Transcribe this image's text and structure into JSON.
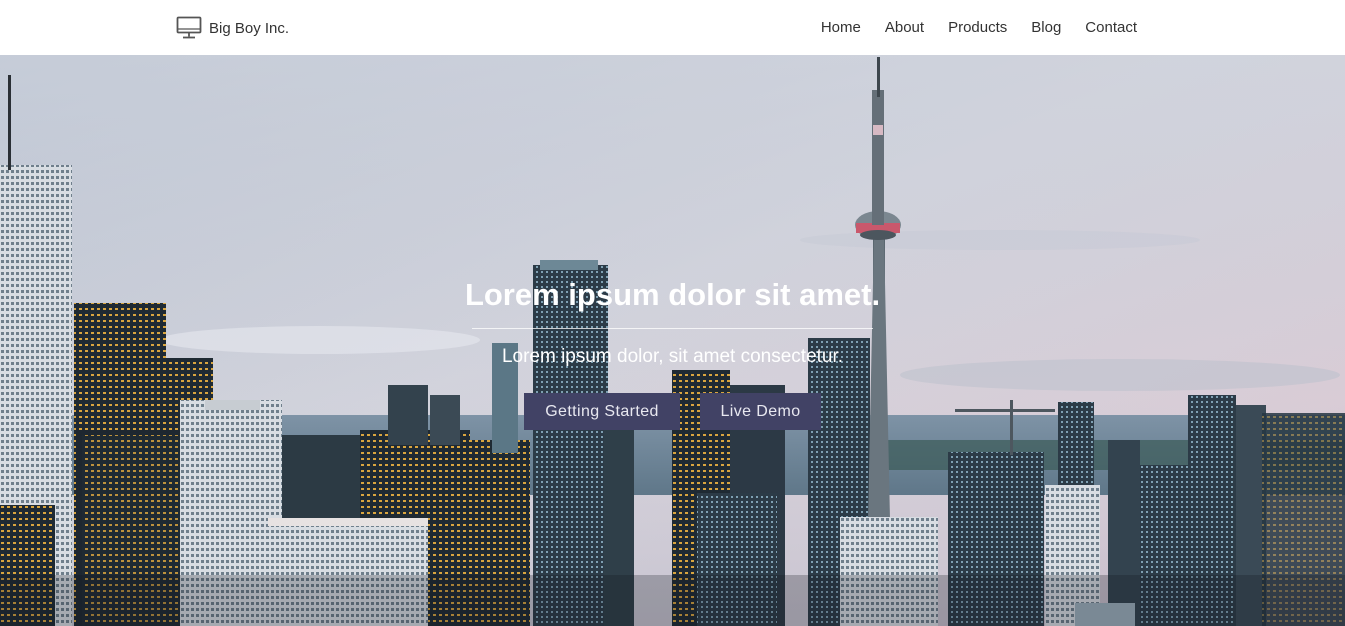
{
  "navbar": {
    "brand_text": "Big Boy Inc.",
    "brand_icon": "monitor-icon",
    "links": [
      "Home",
      "About",
      "Products",
      "Blog",
      "Contact"
    ]
  },
  "hero": {
    "title": "Lorem ipsum dolor sit amet.",
    "subtitle": "Lorem ipsum dolor, sit amet consectetur.",
    "primary_button": "Getting Started",
    "secondary_button": "Live Demo",
    "button_color": "#414265"
  }
}
